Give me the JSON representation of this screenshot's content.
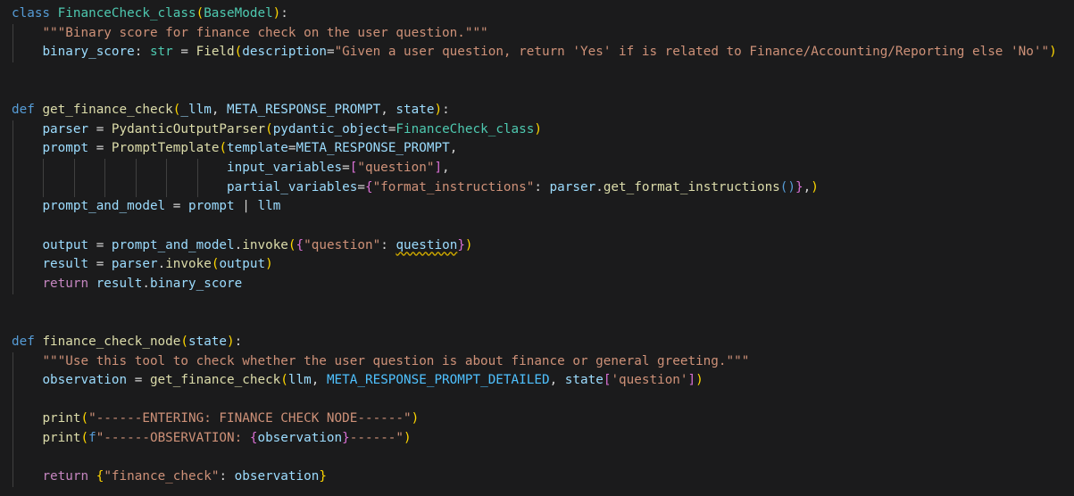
{
  "editor": {
    "language": "python",
    "theme_colors": {
      "background": "#1b1b1c",
      "keyword": "#569cd6",
      "control_keyword": "#c586c0",
      "class_name": "#4ec9b0",
      "function_name": "#dcdcaa",
      "variable": "#9cdcfe",
      "constant": "#4fc1ff",
      "string": "#ce9178",
      "bracket_level1": "#ffd700",
      "bracket_level2": "#da70d6",
      "warning_squiggle": "#cca700"
    },
    "lines": [
      {
        "indent": 0,
        "guides": 0,
        "tokens": [
          [
            "kw",
            "class"
          ],
          [
            "op",
            " "
          ],
          [
            "cls",
            "FinanceCheck_class"
          ],
          [
            "b1",
            "("
          ],
          [
            "cls",
            "BaseModel"
          ],
          [
            "b1",
            ")"
          ],
          [
            "op",
            ":"
          ]
        ]
      },
      {
        "indent": 1,
        "guides": 1,
        "tokens": [
          [
            "str",
            "\"\"\"Binary score for finance check on the user question.\"\"\""
          ]
        ]
      },
      {
        "indent": 1,
        "guides": 1,
        "tokens": [
          [
            "var",
            "binary_score"
          ],
          [
            "op",
            ": "
          ],
          [
            "cls",
            "str"
          ],
          [
            "op",
            " = "
          ],
          [
            "fn",
            "Field"
          ],
          [
            "b1",
            "("
          ],
          [
            "var",
            "description"
          ],
          [
            "op",
            "="
          ],
          [
            "str",
            "\"Given a user question, return 'Yes' if is related to Finance/Accounting/Reporting else 'No'\""
          ],
          [
            "b1",
            ")"
          ]
        ]
      },
      {
        "indent": 0,
        "guides": 0,
        "tokens": []
      },
      {
        "indent": 0,
        "guides": 0,
        "tokens": []
      },
      {
        "indent": 0,
        "guides": 0,
        "tokens": [
          [
            "kw",
            "def"
          ],
          [
            "op",
            " "
          ],
          [
            "fn",
            "get_finance_check"
          ],
          [
            "b1",
            "("
          ],
          [
            "var",
            "_llm"
          ],
          [
            "op",
            ", "
          ],
          [
            "var",
            "META_RESPONSE_PROMPT"
          ],
          [
            "op",
            ", "
          ],
          [
            "var",
            "state"
          ],
          [
            "b1",
            ")"
          ],
          [
            "op",
            ":"
          ]
        ]
      },
      {
        "indent": 1,
        "guides": 1,
        "tokens": [
          [
            "var",
            "parser"
          ],
          [
            "op",
            " = "
          ],
          [
            "fn",
            "PydanticOutputParser"
          ],
          [
            "b1",
            "("
          ],
          [
            "var",
            "pydantic_object"
          ],
          [
            "op",
            "="
          ],
          [
            "cls",
            "FinanceCheck_class"
          ],
          [
            "b1",
            ")"
          ]
        ]
      },
      {
        "indent": 1,
        "guides": 1,
        "tokens": [
          [
            "var",
            "prompt"
          ],
          [
            "op",
            " = "
          ],
          [
            "fn",
            "PromptTemplate"
          ],
          [
            "b1",
            "("
          ],
          [
            "var",
            "template"
          ],
          [
            "op",
            "="
          ],
          [
            "var",
            "META_RESPONSE_PROMPT"
          ],
          [
            "op",
            ","
          ]
        ]
      },
      {
        "indent": 7,
        "guides": 7,
        "tokens": [
          [
            "var",
            "input_variables"
          ],
          [
            "op",
            "="
          ],
          [
            "b2",
            "["
          ],
          [
            "str",
            "\"question\""
          ],
          [
            "b2",
            "]"
          ],
          [
            "op",
            ","
          ]
        ]
      },
      {
        "indent": 7,
        "guides": 7,
        "tokens": [
          [
            "var",
            "partial_variables"
          ],
          [
            "op",
            "="
          ],
          [
            "b2",
            "{"
          ],
          [
            "str",
            "\"format_instructions\""
          ],
          [
            "op",
            ": "
          ],
          [
            "var",
            "parser"
          ],
          [
            "op",
            "."
          ],
          [
            "fn",
            "get_format_instructions"
          ],
          [
            "b3",
            "()"
          ],
          [
            "b2",
            "}"
          ],
          [
            "op",
            ","
          ],
          [
            "b1",
            ")"
          ]
        ]
      },
      {
        "indent": 1,
        "guides": 1,
        "tokens": [
          [
            "var",
            "prompt_and_model"
          ],
          [
            "op",
            " = "
          ],
          [
            "var",
            "prompt"
          ],
          [
            "op",
            " | "
          ],
          [
            "var",
            "llm"
          ]
        ]
      },
      {
        "indent": 0,
        "guides": 1,
        "tokens": []
      },
      {
        "indent": 1,
        "guides": 1,
        "tokens": [
          [
            "var",
            "output"
          ],
          [
            "op",
            " = "
          ],
          [
            "var",
            "prompt_and_model"
          ],
          [
            "op",
            "."
          ],
          [
            "fn",
            "invoke"
          ],
          [
            "b1",
            "("
          ],
          [
            "b2",
            "{"
          ],
          [
            "str",
            "\"question\""
          ],
          [
            "op",
            ": "
          ],
          [
            "warn",
            "question"
          ],
          [
            "b2",
            "}"
          ],
          [
            "b1",
            ")"
          ]
        ]
      },
      {
        "indent": 1,
        "guides": 1,
        "tokens": [
          [
            "var",
            "result"
          ],
          [
            "op",
            " = "
          ],
          [
            "var",
            "parser"
          ],
          [
            "op",
            "."
          ],
          [
            "fn",
            "invoke"
          ],
          [
            "b1",
            "("
          ],
          [
            "var",
            "output"
          ],
          [
            "b1",
            ")"
          ]
        ]
      },
      {
        "indent": 1,
        "guides": 1,
        "tokens": [
          [
            "ctrl",
            "return"
          ],
          [
            "op",
            " "
          ],
          [
            "var",
            "result"
          ],
          [
            "op",
            "."
          ],
          [
            "var",
            "binary_score"
          ]
        ]
      },
      {
        "indent": 0,
        "guides": 0,
        "tokens": []
      },
      {
        "indent": 0,
        "guides": 0,
        "tokens": []
      },
      {
        "indent": 0,
        "guides": 0,
        "tokens": [
          [
            "kw",
            "def"
          ],
          [
            "op",
            " "
          ],
          [
            "fn",
            "finance_check_node"
          ],
          [
            "b1",
            "("
          ],
          [
            "var",
            "state"
          ],
          [
            "b1",
            ")"
          ],
          [
            "op",
            ":"
          ]
        ]
      },
      {
        "indent": 1,
        "guides": 1,
        "tokens": [
          [
            "str",
            "\"\"\"Use this tool to check whether the user question is about finance or general greeting.\"\"\""
          ]
        ]
      },
      {
        "indent": 1,
        "guides": 1,
        "tokens": [
          [
            "var",
            "observation"
          ],
          [
            "op",
            " = "
          ],
          [
            "fn",
            "get_finance_check"
          ],
          [
            "b1",
            "("
          ],
          [
            "var",
            "llm"
          ],
          [
            "op",
            ", "
          ],
          [
            "const",
            "META_RESPONSE_PROMPT_DETAILED"
          ],
          [
            "op",
            ", "
          ],
          [
            "var",
            "state"
          ],
          [
            "b2",
            "["
          ],
          [
            "str",
            "'question'"
          ],
          [
            "b2",
            "]"
          ],
          [
            "b1",
            ")"
          ]
        ]
      },
      {
        "indent": 0,
        "guides": 1,
        "tokens": []
      },
      {
        "indent": 1,
        "guides": 1,
        "tokens": [
          [
            "fn",
            "print"
          ],
          [
            "b1",
            "("
          ],
          [
            "str",
            "\"------ENTERING: FINANCE CHECK NODE------\""
          ],
          [
            "b1",
            ")"
          ]
        ]
      },
      {
        "indent": 1,
        "guides": 1,
        "tokens": [
          [
            "fn",
            "print"
          ],
          [
            "b1",
            "("
          ],
          [
            "fpre",
            "f"
          ],
          [
            "str",
            "\"------OBSERVATION: "
          ],
          [
            "b2",
            "{"
          ],
          [
            "var",
            "observation"
          ],
          [
            "b2",
            "}"
          ],
          [
            "str",
            "------\""
          ],
          [
            "b1",
            ")"
          ]
        ]
      },
      {
        "indent": 0,
        "guides": 1,
        "tokens": []
      },
      {
        "indent": 1,
        "guides": 1,
        "tokens": [
          [
            "ctrl",
            "return"
          ],
          [
            "op",
            " "
          ],
          [
            "b1",
            "{"
          ],
          [
            "str",
            "\"finance_check\""
          ],
          [
            "op",
            ": "
          ],
          [
            "var",
            "observation"
          ],
          [
            "b1",
            "}"
          ]
        ]
      }
    ]
  }
}
